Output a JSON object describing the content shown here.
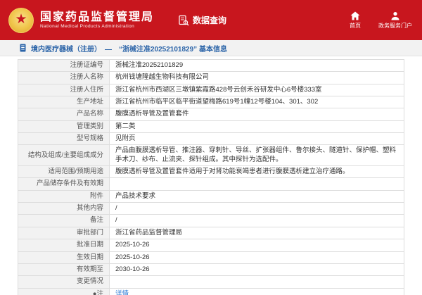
{
  "header": {
    "title": "国家药品监督管理局",
    "subtitle": "National Medical Products Administration",
    "data_query_label": "数据查询",
    "nav": [
      {
        "label": "首页",
        "icon": "home-icon"
      },
      {
        "label": "政务服务门户",
        "icon": "user-icon"
      }
    ],
    "accent_color": "#c8161e"
  },
  "breadcrumb": {
    "text": "境内医疗器械（注册）　—　“浙械注准20252101829” 基本信息"
  },
  "table": {
    "rows": [
      {
        "label": "注册证编号",
        "value": "浙械注准20252101829"
      },
      {
        "label": "注册人名称",
        "value": "杭州钱塘隆越生物科技有限公司"
      },
      {
        "label": "注册人住所",
        "value": "浙江省杭州市西湖区三墩镇紫霞路428号云创禾谷研发中心6号楼333室"
      },
      {
        "label": "生产地址",
        "value": "浙江省杭州市临平区临平街道望梅路619号1幢12号楼104、301、302"
      },
      {
        "label": "产品名称",
        "value": "腹膜透析导管及置管套件"
      },
      {
        "label": "管理类别",
        "value": "第二类"
      },
      {
        "label": "型号规格",
        "value": "见附页"
      },
      {
        "label": "结构及组成/主要组成成分",
        "value": "产品由腹膜透析导管、推注器、穿刺针、导丝、扩张器组件、鲁尔接头、隧道针、保护帽、塑料手术刀、纱布、止流夹、探针组成。其中探针为选配件。"
      },
      {
        "label": "适用范围/预期用途",
        "value": "腹膜透析导管及置管套件适用于对肾功能衰竭患者进行腹膜透析建立治疗通路。"
      },
      {
        "label": "产品储存条件及有效期",
        "value": ""
      },
      {
        "label": "附件",
        "value": "产品技术要求"
      },
      {
        "label": "其他内容",
        "value": "/"
      },
      {
        "label": "备注",
        "value": "/"
      },
      {
        "label": "审批部门",
        "value": "浙江省药品监督管理局"
      },
      {
        "label": "批准日期",
        "value": "2025-10-26"
      },
      {
        "label": "生效日期",
        "value": "2025-10-26"
      },
      {
        "label": "有效期至",
        "value": "2030-10-26"
      },
      {
        "label": "变更情况",
        "value": ""
      },
      {
        "label": "●注",
        "value": "详情",
        "link": true
      }
    ]
  }
}
